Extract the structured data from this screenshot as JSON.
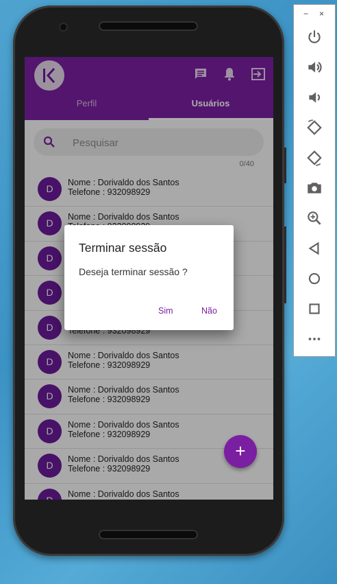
{
  "app": {
    "logo_letter": "K",
    "tabs": [
      {
        "label": "Perfil",
        "active": false
      },
      {
        "label": "Usuários",
        "active": true
      }
    ],
    "actions": [
      "chat-icon",
      "notification-icon",
      "logout-icon"
    ],
    "accent_color": "#7b1fa2"
  },
  "search": {
    "placeholder": "Pesquisar",
    "value": "",
    "counter": "0/40"
  },
  "users": [
    {
      "initial": "D",
      "name": "Nome : Dorivaldo dos Santos",
      "phone": "Telefone : 932098929"
    },
    {
      "initial": "D",
      "name": "Nome : Dorivaldo dos Santos",
      "phone": "Telefone : 932098929"
    },
    {
      "initial": "D",
      "name": "Nome : Dorivaldo dos Santos",
      "phone": "Telefone : 932098929"
    },
    {
      "initial": "D",
      "name": "Nome : Dorivaldo dos Santos",
      "phone": "Telefone : 932098929"
    },
    {
      "initial": "D",
      "name": "Nome : Dorivaldo dos Santos",
      "phone": "Telefone : 932098929"
    },
    {
      "initial": "D",
      "name": "Nome : Dorivaldo dos Santos",
      "phone": "Telefone : 932098929"
    },
    {
      "initial": "D",
      "name": "Nome : Dorivaldo dos Santos",
      "phone": "Telefone : 932098929"
    },
    {
      "initial": "D",
      "name": "Nome : Dorivaldo dos Santos",
      "phone": "Telefone : 932098929"
    },
    {
      "initial": "D",
      "name": "Nome : Dorivaldo dos Santos",
      "phone": "Telefone : 932098929"
    },
    {
      "initial": "D",
      "name": "Nome : Dorivaldo dos Santos",
      "phone": "Telefone : 932098929"
    }
  ],
  "fab": {
    "label": "+"
  },
  "dialog": {
    "title": "Terminar sessão",
    "message": "Deseja terminar sessão ?",
    "confirm_label": "Sim",
    "cancel_label": "Não"
  },
  "emulator_toolbar": {
    "window_controls": {
      "minimize": "−",
      "close": "×"
    },
    "tools": [
      "power-icon",
      "volume-up-icon",
      "volume-down-icon",
      "rotate-left-icon",
      "rotate-right-icon",
      "camera-icon",
      "zoom-icon",
      "back-icon",
      "home-icon",
      "overview-icon",
      "more-icon"
    ]
  }
}
